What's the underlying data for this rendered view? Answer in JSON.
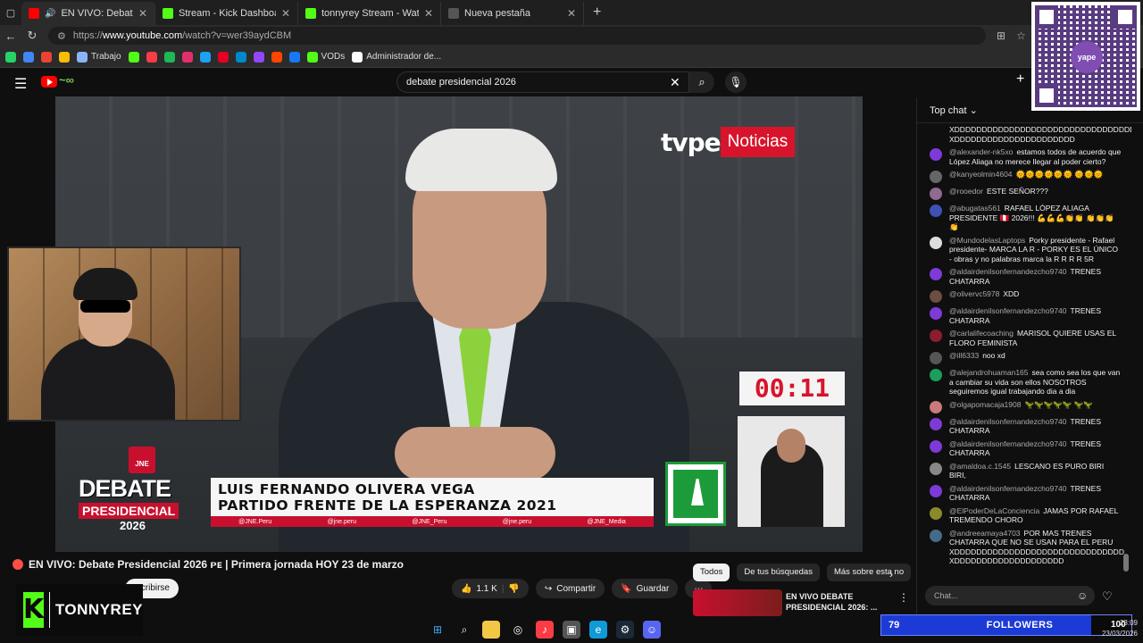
{
  "browser": {
    "tabs": [
      {
        "title": "EN VIVO: Debate Presidencial",
        "color": "#ff0000",
        "active": true
      },
      {
        "title": "Stream - Kick Dashboard",
        "color": "#53fc18",
        "active": false
      },
      {
        "title": "tonnyrey Stream - Watch Live on K",
        "color": "#53fc18",
        "active": false
      },
      {
        "title": "Nueva pestaña",
        "color": "#888888",
        "active": false
      }
    ],
    "url_prefix": "https://",
    "url_host": "www.youtube.com",
    "url_path": "/watch?v=wer39aydCBM",
    "bookmarks": [
      {
        "label": "",
        "color": "#25d366"
      },
      {
        "label": "",
        "color": "#4285f4"
      },
      {
        "label": "",
        "color": "#ea4335"
      },
      {
        "label": "",
        "color": "#fbbc05"
      },
      {
        "label": "Trabajo",
        "color": "#8ab4f8"
      },
      {
        "label": "",
        "color": "#53fc18"
      },
      {
        "label": "",
        "color": "#fc3c44"
      },
      {
        "label": "",
        "color": "#1db954"
      },
      {
        "label": "",
        "color": "#e1306c"
      },
      {
        "label": "",
        "color": "#1da1f2"
      },
      {
        "label": "",
        "color": "#e60023"
      },
      {
        "label": "",
        "color": "#0088cc"
      },
      {
        "label": "",
        "color": "#9146ff"
      },
      {
        "label": "",
        "color": "#ff4500"
      },
      {
        "label": "",
        "color": "#1877f2"
      },
      {
        "label": "VODs",
        "color": "#53fc18"
      },
      {
        "label": "Administrador de...",
        "color": "#ffffff"
      }
    ]
  },
  "youtube": {
    "search_value": "debate presidencial 2026"
  },
  "video": {
    "channel_badge": "tvpe",
    "channel_badge_pe": "pe",
    "channel_tag": "Noticias",
    "timer": "00:11",
    "jne": "JNE",
    "debate_big": "DEBATE",
    "debate_pres": "PRESIDENCIAL",
    "debate_year": "2026",
    "candidate_name": "LUIS FERNANDO OLIVERA VEGA",
    "candidate_party": "PARTIDO FRENTE DE LA ESPERANZA 2021",
    "socials": [
      "@JNE.Peru",
      "@jne.peru",
      "@JNE_Peru",
      "@jne.peru",
      "@JNE_Media"
    ]
  },
  "streamer": {
    "name": "TONNYREY",
    "k": "K"
  },
  "below": {
    "title": "EN VIVO: Debate Presidencial 2026 ᴘᴇ | Primera jornada HOY 23 de marzo",
    "subscribe": "Suscribirse",
    "likes": "1.1 K",
    "share": "Compartir",
    "save": "Guardar",
    "chips": [
      "Todos",
      "De tus búsquedas",
      "Más sobre esta no"
    ],
    "rec_title": "EN VIVO DEBATE PRESIDENCIAL 2026: ..."
  },
  "chat": {
    "header": "Top chat",
    "input_placeholder": "Chat...",
    "messages": [
      {
        "author": "",
        "text": "XDDDDDDDDDDDDDDDDDDDDDDDDDDDDDDDDD XDDDDDDDDDDDDDDDDDDDDDD",
        "color": "#0f0f0f"
      },
      {
        "author": "@alexander-nk5xo",
        "text": "estamos todos de acuerdo que López Aliaga no merece llegar al poder cierto?",
        "color": "#7e3ad6"
      },
      {
        "author": "@kanyeolmin4604",
        "text": "🌞🌞🌞🌞🌞🌞 🌞🌞🌞",
        "color": "#666666"
      },
      {
        "author": "@rooedor",
        "text": "ESTE SEÑOR???",
        "color": "#8e6b8f"
      },
      {
        "author": "@abugatas561",
        "text": "RAFAEL LÓPEZ ALIAGA PRESIDENTE 🇵🇪 2026!!! 💪💪💪👏👏 👏👏👏👏",
        "color": "#3f51b5"
      },
      {
        "author": "@MundodelasLaptops",
        "text": "Porky presidente - Rafael presidente- MARCA LA R - PORKY ES EL ÚNICO - obras y no palabras marca la R R R R 5R",
        "color": "#dddddd"
      },
      {
        "author": "@aldairdenilsonfernandezcho9740",
        "text": "TRENES CHATARRA",
        "color": "#7e3ad6"
      },
      {
        "author": "@olivervc5978",
        "text": "XDD",
        "color": "#6d4c41"
      },
      {
        "author": "@aldairdenilsonfernandezcho9740",
        "text": "TRENES CHATARRA",
        "color": "#7e3ad6"
      },
      {
        "author": "@carlalifecoaching",
        "text": "MARISOL QUIERE USAS EL FLORO FEMINISTA",
        "color": "#8b1e2e"
      },
      {
        "author": "@ill6333",
        "text": "noo xd",
        "color": "#555555"
      },
      {
        "author": "@alejandrohuaman165",
        "text": "sea como sea los que van a cambiar su vida son ellos NOSOTROS seguiremos igual trabajando dia a dia",
        "color": "#1b9e5a"
      },
      {
        "author": "@olgapomacaja1908",
        "text": "🦖🦖🦖🦖🦖 🦖🦖",
        "color": "#c97a7a"
      },
      {
        "author": "@aldairdenilsonfernandezcho9740",
        "text": "TRENES CHATARRA",
        "color": "#7e3ad6"
      },
      {
        "author": "@aldairdenilsonfernandezcho9740",
        "text": "TRENES CHATARRA",
        "color": "#7e3ad6"
      },
      {
        "author": "@amaldoa.c.1545",
        "text": "LESCANO ES PURO BIRI BIRI,",
        "color": "#888888"
      },
      {
        "author": "@aldairdenilsonfernandezcho9740",
        "text": "TRENES CHATARRA",
        "color": "#7e3ad6"
      },
      {
        "author": "@ElPoderDeLaConciencia",
        "text": "JAMAS POR RAFAEL TREMENDO CHORO",
        "color": "#8a8a2a"
      },
      {
        "author": "@andreeamaya4703",
        "text": "POR MAS TRENES CHATARRA QUE NO SE USAN PARA EL PERU XDDDDDDDDDDDDDDDDDDDDDDDDDDDDDDD XDDDDDDDDDDDDDDDDDDDD",
        "color": "#456b8a"
      }
    ]
  },
  "overlay": {
    "qr_brand": "yape",
    "followers_count": "79",
    "followers_label": "FOLLOWERS",
    "followers_progress": 0.2
  },
  "system": {
    "time": "23:09",
    "date": "23/03/2026",
    "battery": "100"
  }
}
